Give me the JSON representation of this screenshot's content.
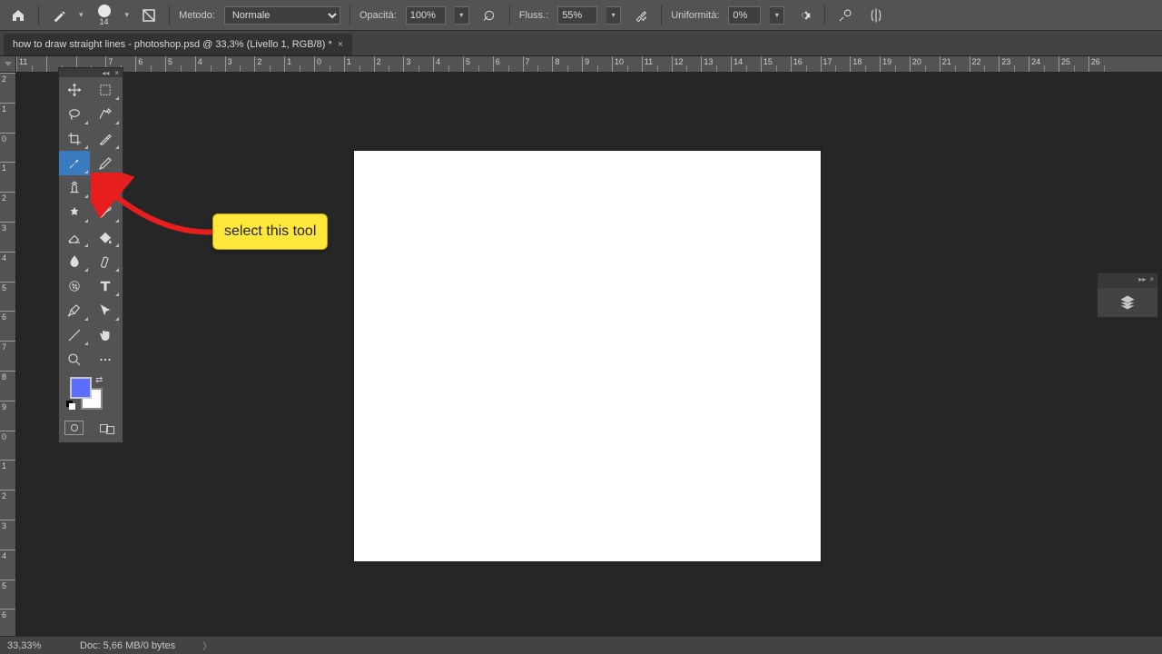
{
  "options_bar": {
    "metodo_label": "Metodo:",
    "metodo_value": "Normale",
    "opacita_label": "Opacità:",
    "opacita_value": "100%",
    "flusso_label": "Fluss.:",
    "flusso_value": "55%",
    "uniformita_label": "Uniformità:",
    "uniformita_value": "0%",
    "brush_size": "14"
  },
  "doc_tab": {
    "title": "how to draw straight lines - photoshop.psd @ 33,3% (Livello 1, RGB/8) *"
  },
  "ruler_h": [
    "11",
    "",
    "",
    "7",
    "6",
    "5",
    "4",
    "3",
    "2",
    "1",
    "0",
    "1",
    "2",
    "3",
    "4",
    "5",
    "6",
    "7",
    "8",
    "9",
    "10",
    "11",
    "12",
    "13",
    "14",
    "15",
    "16",
    "17",
    "18",
    "19",
    "20",
    "21",
    "22",
    "23",
    "24",
    "25",
    "26"
  ],
  "ruler_v": [
    "2",
    "1",
    "0",
    "1",
    "2",
    "3",
    "4",
    "5",
    "6",
    "7",
    "8",
    "9",
    "0",
    "1",
    "2",
    "3",
    "4",
    "5",
    "6"
  ],
  "tools": [
    {
      "name": "move-tool",
      "selected": false,
      "flyout": false
    },
    {
      "name": "marquee-tool",
      "selected": false,
      "flyout": true
    },
    {
      "name": "lasso-tool",
      "selected": false,
      "flyout": true
    },
    {
      "name": "quick-selection-tool",
      "selected": false,
      "flyout": true
    },
    {
      "name": "crop-tool",
      "selected": false,
      "flyout": true
    },
    {
      "name": "eyedropper-tool",
      "selected": false,
      "flyout": true
    },
    {
      "name": "brush-tool",
      "selected": true,
      "flyout": true
    },
    {
      "name": "pencil-tool",
      "selected": false,
      "flyout": false
    },
    {
      "name": "clone-stamp-tool",
      "selected": false,
      "flyout": true
    },
    {
      "name": "",
      "selected": false,
      "flyout": false
    },
    {
      "name": "healing-brush-tool",
      "selected": false,
      "flyout": true
    },
    {
      "name": "history-brush-tool",
      "selected": false,
      "flyout": true
    },
    {
      "name": "eraser-tool",
      "selected": false,
      "flyout": true
    },
    {
      "name": "paint-bucket-tool",
      "selected": false,
      "flyout": true
    },
    {
      "name": "blur-tool",
      "selected": false,
      "flyout": true
    },
    {
      "name": "dodge-tool",
      "selected": false,
      "flyout": true
    },
    {
      "name": "sponge-tool",
      "selected": false,
      "flyout": false
    },
    {
      "name": "type-tool",
      "selected": false,
      "flyout": true
    },
    {
      "name": "pen-tool",
      "selected": false,
      "flyout": true
    },
    {
      "name": "path-selection-tool",
      "selected": false,
      "flyout": true
    },
    {
      "name": "line-tool",
      "selected": false,
      "flyout": true
    },
    {
      "name": "hand-tool",
      "selected": false,
      "flyout": false
    },
    {
      "name": "zoom-tool",
      "selected": false,
      "flyout": false
    },
    {
      "name": "more-tool",
      "selected": false,
      "flyout": false
    }
  ],
  "colors": {
    "foreground": "#5a6dff",
    "background": "#ffffff"
  },
  "annotation": {
    "text": "select this tool"
  },
  "mini_panel": {
    "tab": ""
  },
  "status": {
    "zoom": "33,33%",
    "doc_info": "Doc: 5,66 MB/0 bytes"
  }
}
